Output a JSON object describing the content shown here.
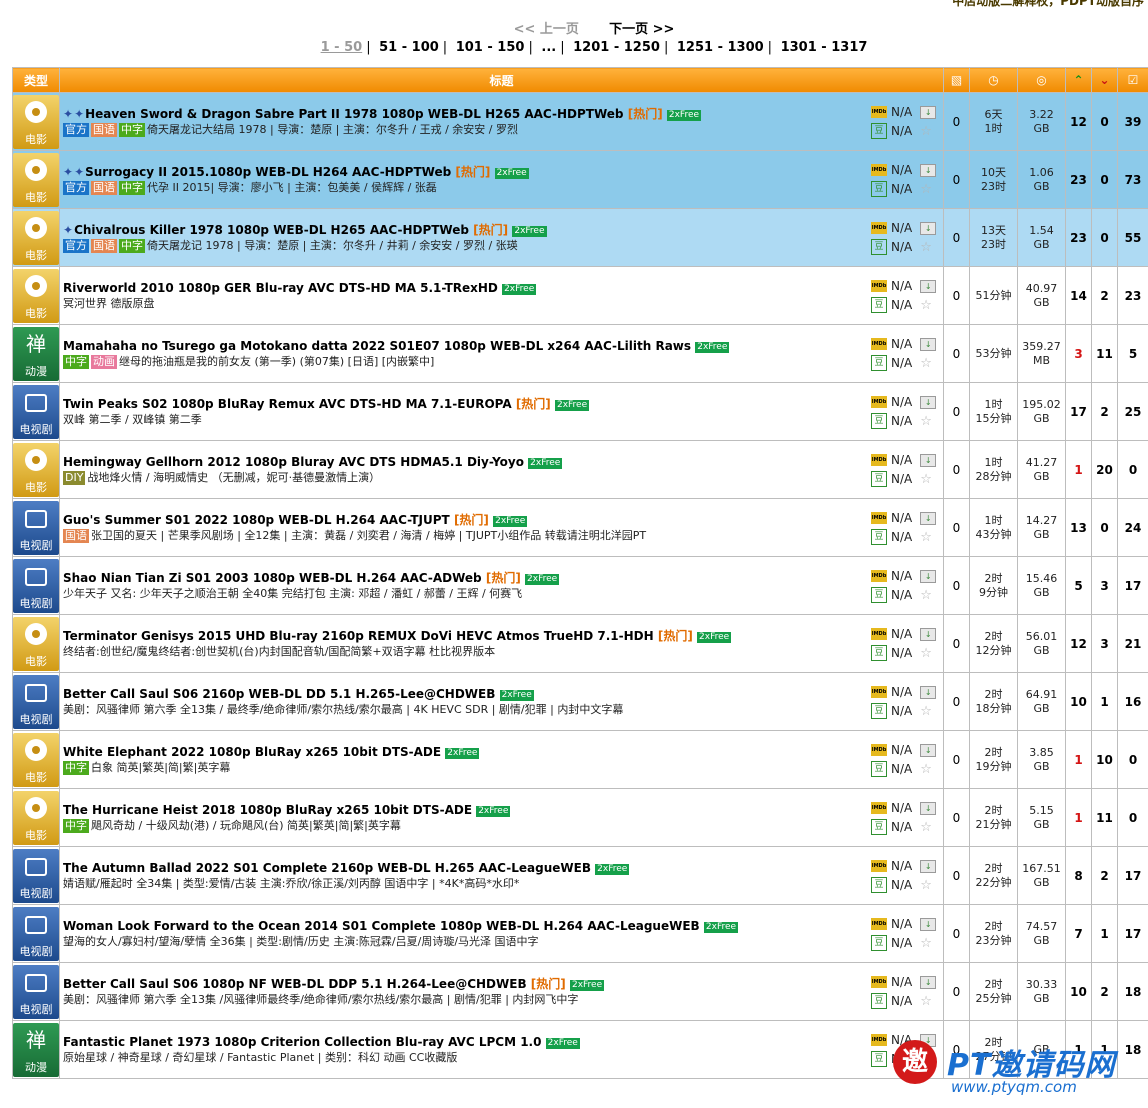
{
  "top_note": "中店动版二解释权，PDPT动版自序",
  "pager": {
    "prev": "<< 上一页",
    "next": "下一页 >>",
    "ranges": [
      "1 - 50",
      "51 - 100",
      "101 - 150",
      "...",
      "1201 - 1250",
      "1251 - 1300",
      "1301 - 1317"
    ]
  },
  "headers": {
    "type": "类型",
    "title": "标题"
  },
  "rating_na": "N/A",
  "rows": [
    {
      "cat": "movie",
      "cat_label": "电影",
      "pins": 2,
      "title": "Heaven Sword & Dragon Sabre Part II 1978 1080p WEB-DL H265 AAC-HDPTWeb",
      "hot": "[热门]",
      "free": "2xFree",
      "tags": [
        [
          "gf",
          "官方"
        ],
        [
          "gy",
          "国语"
        ],
        [
          "zz",
          "中字"
        ]
      ],
      "sub": "倚天屠龙记大结局 1978 | 导演：楚原 | 主演：尔冬升 / 王戎 / 余安安 / 罗烈",
      "comments": "0",
      "time": [
        "6天",
        "1时"
      ],
      "size": [
        "3.22",
        "GB"
      ],
      "seeds": "12",
      "leech": "0",
      "done": "39",
      "hl": "hl"
    },
    {
      "cat": "movie",
      "cat_label": "电影",
      "pins": 2,
      "title": "Surrogacy II 2015.1080p WEB-DL H264 AAC-HDPTWeb",
      "hot": "[热门]",
      "free": "2xFree",
      "tags": [
        [
          "gf",
          "官方"
        ],
        [
          "gy",
          "国语"
        ],
        [
          "zz",
          "中字"
        ]
      ],
      "sub": "代孕 II 2015| 导演：廖小飞 | 主演：包美美 / 侯辉辉 / 张磊",
      "comments": "0",
      "time": [
        "10天",
        "23时"
      ],
      "size": [
        "1.06",
        "GB"
      ],
      "seeds": "23",
      "leech": "0",
      "done": "73",
      "hl": "hl"
    },
    {
      "cat": "movie",
      "cat_label": "电影",
      "pins": 1,
      "title": "Chivalrous Killer 1978 1080p WEB-DL H265 AAC-HDPTWeb",
      "hot": "[热门]",
      "free": "2xFree",
      "tags": [
        [
          "gf",
          "官方"
        ],
        [
          "gy",
          "国语"
        ],
        [
          "zz",
          "中字"
        ]
      ],
      "sub": "倚天屠龙记 1978 | 导演：楚原 | 主演：尔冬升 / 井莉 / 余安安 / 罗烈 / 张瑛",
      "comments": "0",
      "time": [
        "13天",
        "23时"
      ],
      "size": [
        "1.54",
        "GB"
      ],
      "seeds": "23",
      "leech": "0",
      "done": "55",
      "hl": "hl2"
    },
    {
      "cat": "movie",
      "cat_label": "电影",
      "pins": 0,
      "title": "Riverworld 2010 1080p GER Blu-ray AVC DTS-HD MA 5.1-TRexHD",
      "hot": "",
      "free": "2xFree",
      "tags": [],
      "sub": "冥河世界 德版原盘",
      "comments": "0",
      "time": [
        "51分钟",
        ""
      ],
      "size": [
        "40.97",
        "GB"
      ],
      "seeds": "14",
      "leech": "2",
      "done": "23",
      "hl": ""
    },
    {
      "cat": "anime",
      "cat_label": "动漫",
      "pins": 0,
      "title": "Mamahaha no Tsurego ga Motokano datta 2022 S01E07 1080p WEB-DL x264 AAC-Lilith Raws",
      "hot": "",
      "free": "2xFree",
      "tags": [
        [
          "zz",
          "中字"
        ],
        [
          "dh",
          "动画"
        ]
      ],
      "sub": "继母的拖油瓶是我的前女友 (第一季) (第07集) [日语] [内嵌繁中]",
      "comments": "0",
      "time": [
        "53分钟",
        ""
      ],
      "size": [
        "359.27",
        "MB"
      ],
      "seeds": "3",
      "leech": "11",
      "done": "5",
      "hl": "",
      "seedred": true
    },
    {
      "cat": "tv",
      "cat_label": "电视剧",
      "pins": 0,
      "title": "Twin Peaks S02 1080p BluRay Remux AVC DTS-HD MA 7.1-EUROPA",
      "hot": "[热门]",
      "free": "2xFree",
      "tags": [],
      "sub": "双峰 第二季 / 双峰镇 第二季",
      "comments": "0",
      "time": [
        "1时",
        "15分钟"
      ],
      "size": [
        "195.02",
        "GB"
      ],
      "seeds": "17",
      "leech": "2",
      "done": "25",
      "hl": ""
    },
    {
      "cat": "movie",
      "cat_label": "电影",
      "pins": 0,
      "title": "Hemingway Gellhorn 2012 1080p Bluray AVC DTS HDMA5.1 Diy-Yoyo",
      "hot": "",
      "free": "2xFree",
      "tags": [
        [
          "diy",
          "DIY"
        ]
      ],
      "sub": "战地烽火情 / 海明威情史 （无删减，妮可·基德曼激情上演）",
      "comments": "0",
      "time": [
        "1时",
        "28分钟"
      ],
      "size": [
        "41.27",
        "GB"
      ],
      "seeds": "1",
      "leech": "20",
      "done": "0",
      "hl": "",
      "seedred": true
    },
    {
      "cat": "tv",
      "cat_label": "电视剧",
      "pins": 0,
      "title": "Guo's Summer S01 2022 1080p WEB-DL H.264 AAC-TJUPT",
      "hot": "[热门]",
      "free": "2xFree",
      "tags": [
        [
          "gy",
          "国语"
        ]
      ],
      "sub": "张卫国的夏天 | 芒果季风剧场 | 全12集 | 主演：黄磊 / 刘奕君 / 海清 / 梅婷 | TJUPT小组作品 转载请注明北洋园PT",
      "comments": "0",
      "time": [
        "1时",
        "43分钟"
      ],
      "size": [
        "14.27",
        "GB"
      ],
      "seeds": "13",
      "leech": "0",
      "done": "24",
      "hl": ""
    },
    {
      "cat": "tv",
      "cat_label": "电视剧",
      "pins": 0,
      "title": "Shao Nian Tian Zi S01 2003 1080p WEB-DL H.264 AAC-ADWeb",
      "hot": "[热门]",
      "free": "2xFree",
      "tags": [],
      "sub": "少年天子 又名: 少年天子之顺治王朝 全40集 完结打包 主演: 邓超 / 潘虹 / 郝蕾 / 王辉 / 何赛飞",
      "comments": "0",
      "time": [
        "2时",
        "9分钟"
      ],
      "size": [
        "15.46",
        "GB"
      ],
      "seeds": "5",
      "leech": "3",
      "done": "17",
      "hl": ""
    },
    {
      "cat": "movie",
      "cat_label": "电影",
      "pins": 0,
      "title": "Terminator Genisys 2015 UHD Blu-ray 2160p REMUX DoVi HEVC Atmos TrueHD 7.1-HDH",
      "hot": "[热门]",
      "free": "2xFree",
      "tags": [],
      "sub": "终结者:创世纪/魔鬼终结者:创世契机(台)内封国配音轨/国配简繁+双语字幕 杜比视界版本",
      "comments": "0",
      "time": [
        "2时",
        "12分钟"
      ],
      "size": [
        "56.01",
        "GB"
      ],
      "seeds": "12",
      "leech": "3",
      "done": "21",
      "hl": ""
    },
    {
      "cat": "tv",
      "cat_label": "电视剧",
      "pins": 0,
      "title": "Better Call Saul S06 2160p WEB-DL DD 5.1 H.265-Lee@CHDWEB",
      "hot": "",
      "free": "2xFree",
      "tags": [],
      "sub": "美剧：风骚律师 第六季 全13集 / 最终季/绝命律师/索尔热线/索尔最高 | 4K HEVC SDR | 剧情/犯罪 | 内封中文字幕",
      "comments": "0",
      "time": [
        "2时",
        "18分钟"
      ],
      "size": [
        "64.91",
        "GB"
      ],
      "seeds": "10",
      "leech": "1",
      "done": "16",
      "hl": ""
    },
    {
      "cat": "movie",
      "cat_label": "电影",
      "pins": 0,
      "title": "White Elephant 2022 1080p BluRay x265 10bit DTS-ADE",
      "hot": "",
      "free": "2xFree",
      "tags": [
        [
          "zz",
          "中字"
        ]
      ],
      "sub": "白象 简英|繁英|简|繁|英字幕",
      "comments": "0",
      "time": [
        "2时",
        "19分钟"
      ],
      "size": [
        "3.85",
        "GB"
      ],
      "seeds": "1",
      "leech": "10",
      "done": "0",
      "hl": "",
      "seedred": true
    },
    {
      "cat": "movie",
      "cat_label": "电影",
      "pins": 0,
      "title": "The Hurricane Heist 2018 1080p BluRay x265 10bit DTS-ADE",
      "hot": "",
      "free": "2xFree",
      "tags": [
        [
          "zz",
          "中字"
        ]
      ],
      "sub": "飓风奇劫 / 十级风劫(港) / 玩命飓风(台) 简英|繁英|简|繁|英字幕",
      "comments": "0",
      "time": [
        "2时",
        "21分钟"
      ],
      "size": [
        "5.15",
        "GB"
      ],
      "seeds": "1",
      "leech": "11",
      "done": "0",
      "hl": "",
      "seedred": true
    },
    {
      "cat": "tv",
      "cat_label": "电视剧",
      "pins": 0,
      "title": "The Autumn Ballad 2022 S01 Complete 2160p WEB-DL H.265 AAC-LeagueWEB",
      "hot": "",
      "free": "2xFree",
      "tags": [],
      "sub": "婧语赋/雁起时 全34集 | 类型:爱情/古装 主演:乔欣/徐正溪/刘丙醇 国语中字 | *4K*高码*水印*",
      "comments": "0",
      "time": [
        "2时",
        "22分钟"
      ],
      "size": [
        "167.51",
        "GB"
      ],
      "seeds": "8",
      "leech": "2",
      "done": "17",
      "hl": ""
    },
    {
      "cat": "tv",
      "cat_label": "电视剧",
      "pins": 0,
      "title": "Woman Look Forward to the Ocean 2014 S01 Complete 1080p WEB-DL H.264 AAC-LeagueWEB",
      "hot": "",
      "free": "2xFree",
      "tags": [],
      "sub": "望海的女人/寡妇村/望海/孽情 全36集 | 类型:剧情/历史 主演:陈冠霖/吕夏/周诗璇/马光泽 国语中字",
      "comments": "0",
      "time": [
        "2时",
        "23分钟"
      ],
      "size": [
        "74.57",
        "GB"
      ],
      "seeds": "7",
      "leech": "1",
      "done": "17",
      "hl": ""
    },
    {
      "cat": "tv",
      "cat_label": "电视剧",
      "pins": 0,
      "title": "Better Call Saul S06 1080p NF WEB-DL DDP 5.1 H.264-Lee@CHDWEB",
      "hot": "[热门]",
      "free": "2xFree",
      "tags": [],
      "sub": "美剧：风骚律师 第六季 全13集 /风骚律师最终季/绝命律师/索尔热线/索尔最高 | 剧情/犯罪 | 内封网飞中字",
      "comments": "0",
      "time": [
        "2时",
        "25分钟"
      ],
      "size": [
        "30.33",
        "GB"
      ],
      "seeds": "10",
      "leech": "2",
      "done": "18",
      "hl": ""
    },
    {
      "cat": "anime",
      "cat_label": "动漫",
      "pins": 0,
      "title": "Fantastic Planet 1973 1080p Criterion Collection Blu-ray AVC LPCM 1.0",
      "hot": "",
      "free": "2xFree",
      "tags": [],
      "sub": "原始星球 / 神奇星球 / 奇幻星球 / Fantastic Planet | 类别：科幻 动画 CC收藏版",
      "comments": "0",
      "time": [
        "2时",
        "27分钟"
      ],
      "size": [
        "",
        "GB"
      ],
      "seeds": "1",
      "leech": "1",
      "done": "18",
      "hl": ""
    }
  ],
  "watermark": {
    "seal": "邀",
    "brand": "PT邀请码网",
    "url": "www.ptyqm.com"
  }
}
